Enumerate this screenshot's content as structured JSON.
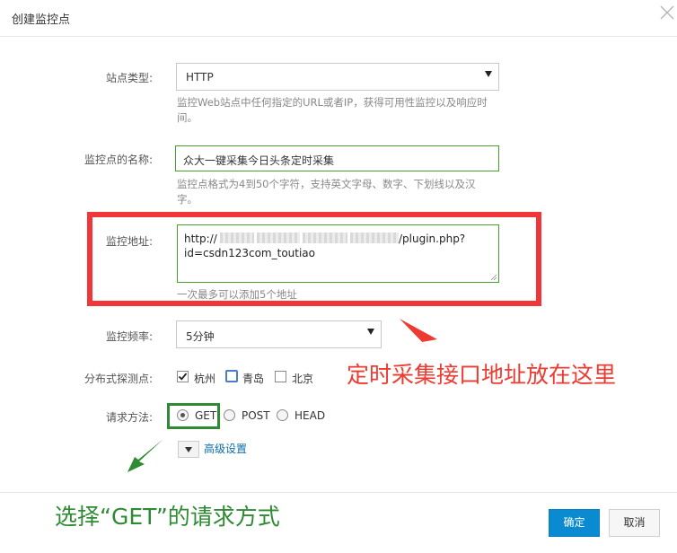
{
  "dialog": {
    "title": "创建监控点"
  },
  "site_type": {
    "label": "站点类型:",
    "value": "HTTP",
    "help_line1": "监控Web站点中任何指定的URL或者IP，获得可用性监控以及响应时",
    "help_line2": "间。"
  },
  "monitor_name": {
    "label": "监控点的名称:",
    "value": "众大一键采集今日头条定时采集",
    "help_line1": "监控点格式为4到50个字符，支持英文字母、数字、下划线以及汉",
    "help_line2": "字。"
  },
  "monitor_url": {
    "label": "监控地址:",
    "line1_prefix": "http://",
    "line1_suffix": "/plugin.php?",
    "line2": "id=csdn123com_toutiao",
    "help": "一次最多可以添加5个地址"
  },
  "frequency": {
    "label": "监控频率:",
    "value": "5分钟"
  },
  "probes": {
    "label": "分布式探测点:",
    "items": [
      {
        "name": "杭州",
        "checked": true
      },
      {
        "name": "青岛",
        "checked": false
      },
      {
        "name": "北京",
        "checked": false
      }
    ]
  },
  "method": {
    "label": "请求方法:",
    "options": [
      "GET",
      "POST",
      "HEAD"
    ],
    "selected": "GET"
  },
  "advanced": {
    "label": "高级设置"
  },
  "annotations": {
    "url_note": "定时采集接口地址放在这里",
    "method_note": "选择“GET”的请求方式"
  },
  "footer": {
    "ok_label": "确定",
    "cancel_label": "取消"
  },
  "colors": {
    "primary": "#0a8ad0",
    "annotation_red": "#ee3a30",
    "annotation_green": "#2f8a34",
    "valid_border": "#4aa02c"
  }
}
